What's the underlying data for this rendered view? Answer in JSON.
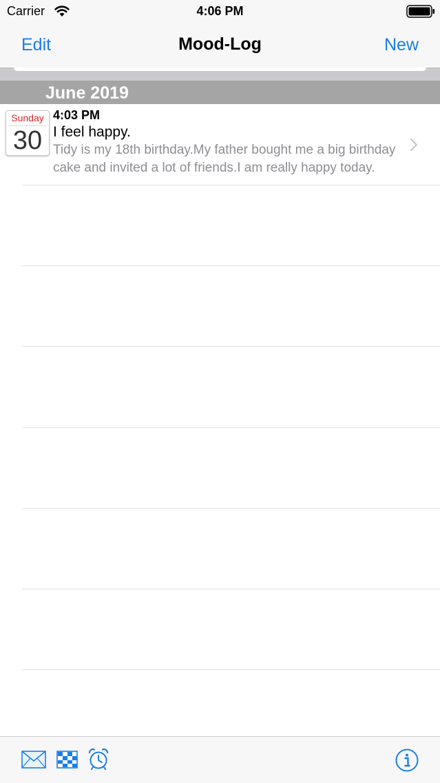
{
  "status_bar": {
    "carrier": "Carrier",
    "time": "4:06 PM",
    "wifi_icon": "wifi-icon",
    "battery_icon": "battery-icon"
  },
  "nav": {
    "edit_label": "Edit",
    "title": "Mood-Log",
    "new_label": "New",
    "accent_color": "#1a7ee6"
  },
  "section": {
    "title": "June 2019",
    "header_color": "#a5a5a5"
  },
  "entries": [
    {
      "weekday": "Sunday",
      "day": "30",
      "time": "4:03 PM",
      "title": "I feel happy.",
      "body": "Tidy is my 18th birthday.My father bought me a big birthday cake and invited a lot of friends.I am really happy today.",
      "chevron_icon": "chevron-right-icon"
    }
  ],
  "toolbar": {
    "icons": [
      "mail-icon",
      "chart-icon",
      "alarm-clock-icon",
      "info-icon"
    ]
  }
}
